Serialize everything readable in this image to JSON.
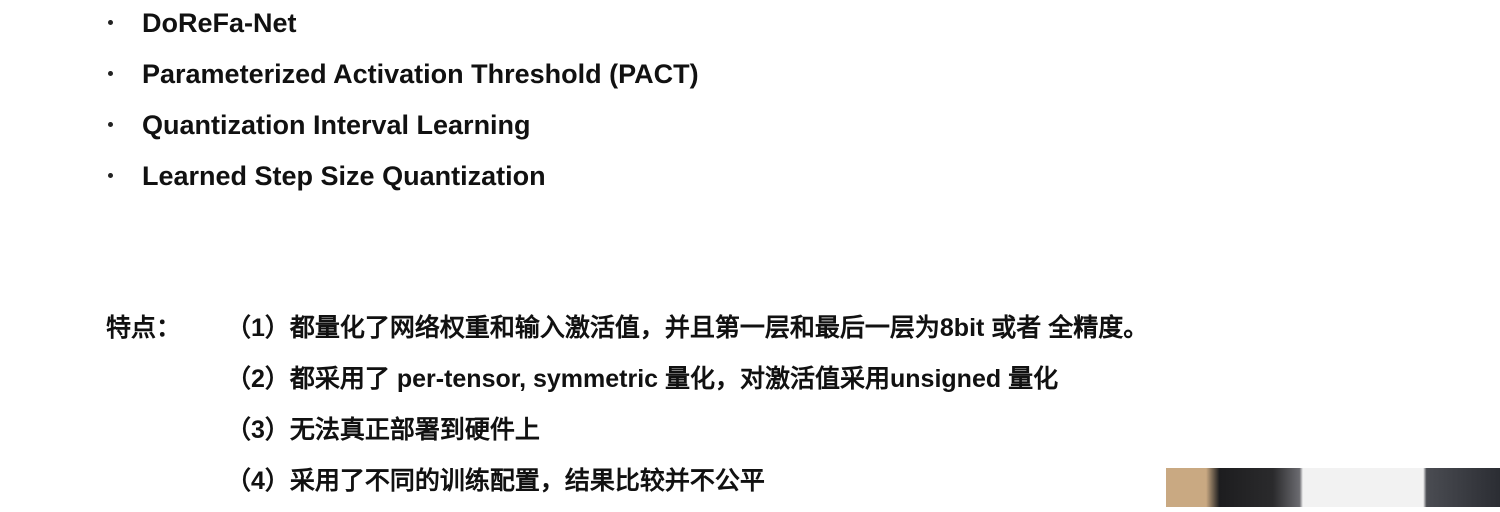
{
  "bullets": [
    "DoReFa-Net",
    "Parameterized Activation Threshold (PACT)",
    "Quantization Interval Learning",
    "Learned Step Size Quantization"
  ],
  "features": {
    "label": "特点：",
    "items": [
      "（1）都量化了网络权重和输入激活值，并且第一层和最后一层为8bit 或者 全精度。",
      "（2）都采用了 per-tensor, symmetric 量化，对激活值采用unsigned 量化",
      "（3）无法真正部署到硬件上",
      "（4）采用了不同的训练配置，结果比较并不公平"
    ]
  }
}
